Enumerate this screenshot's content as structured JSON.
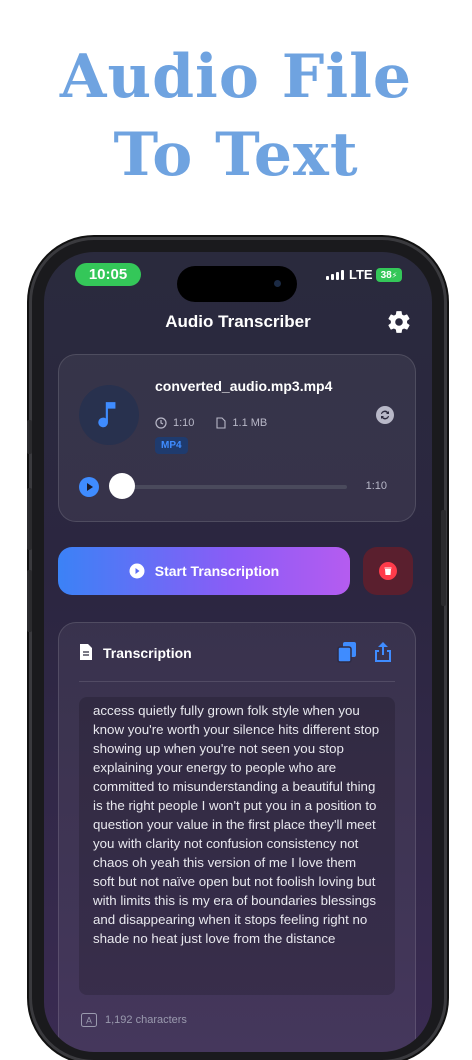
{
  "headline": {
    "line1": "Audio File",
    "line2": "To Text"
  },
  "status": {
    "time": "10:05",
    "network": "LTE",
    "battery": "38"
  },
  "nav": {
    "title": "Audio Transcriber",
    "settings_icon": "gear-icon"
  },
  "file": {
    "name": "converted_audio.mp3.mp4",
    "duration": "1:10",
    "size": "1.1 MB",
    "format": "MP4",
    "player_time": "1:10",
    "playback_progress": 0
  },
  "actions": {
    "start_label": "Start Transcription"
  },
  "transcription": {
    "title": "Transcription",
    "text": "access quietly fully grown folk style when you know you're worth your silence hits different stop showing up when you're not seen you stop explaining your energy to people who are committed to misunderstanding a beautiful thing is the right people I won't put you in a position to question your value in the first place they'll meet you with clarity not confusion consistency not chaos oh yeah this version of me I love them soft but not naïve open but not foolish loving but with limits this is my era of boundaries blessings and disappearing when it stops feeling right no shade no heat just love from the distance",
    "char_count": "1,192 characters"
  },
  "colors": {
    "accent": "#3f8cff",
    "headline": "#6fa3e0",
    "status_green": "#34c759",
    "delete": "#ff3b4a"
  }
}
